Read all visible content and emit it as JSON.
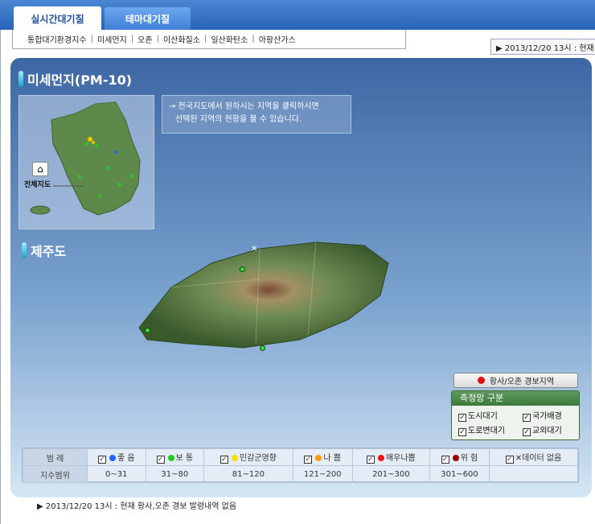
{
  "tabs": {
    "realtime": "실시간대기질",
    "theme": "테마대기질"
  },
  "submenu": [
    "통합대기환경지수",
    "미세먼지",
    "오존",
    "이산화질소",
    "일산화탄소",
    "아황산가스"
  ],
  "submenu_sep": "|",
  "date_box": "▶ 2013/12/20 13시 : 현재",
  "section_pm10": "미세먼지(PM-10)",
  "minimap": {
    "home_glyph": "⌂",
    "home_label": "전체지도"
  },
  "hint": {
    "line1": "→ 전국지도에서 원하시는 지역을 클릭하시면",
    "line2": "선택된 지역의 현황을 볼 수 있습니다."
  },
  "section_region": "제주도",
  "alert_button": "황사/오존 경보지역",
  "network": {
    "title": "측정망 구분",
    "items": [
      "도시대기",
      "국가배경",
      "도로변대기",
      "교외대기"
    ]
  },
  "legend": {
    "row1_header": "범 례",
    "row2_header": "지수범위",
    "checkmark": "✓",
    "no_data_mark": "✕",
    "levels": [
      {
        "label": "좋 음",
        "range": "0~31",
        "color": "#1e64ff"
      },
      {
        "label": "보 통",
        "range": "31~80",
        "color": "#22cc22"
      },
      {
        "label": "민감군영향",
        "range": "81~120",
        "color": "#f4e000"
      },
      {
        "label": "나 쁨",
        "range": "121~200",
        "color": "#ff9900"
      },
      {
        "label": "매우나쁨",
        "range": "201~300",
        "color": "#ee1111"
      },
      {
        "label": "위 험",
        "range": "301~600",
        "color": "#990000"
      },
      {
        "label": "데이터 없음",
        "range": "",
        "color": "#888888"
      }
    ]
  },
  "footer": "▶ 2013/12/20 13시 : 현재 황사,오존 경보 발령내역 없음",
  "stations": [
    {
      "color": "#33dd33"
    },
    {
      "color": "#33dd33"
    },
    {
      "color": "#33dd33"
    }
  ]
}
